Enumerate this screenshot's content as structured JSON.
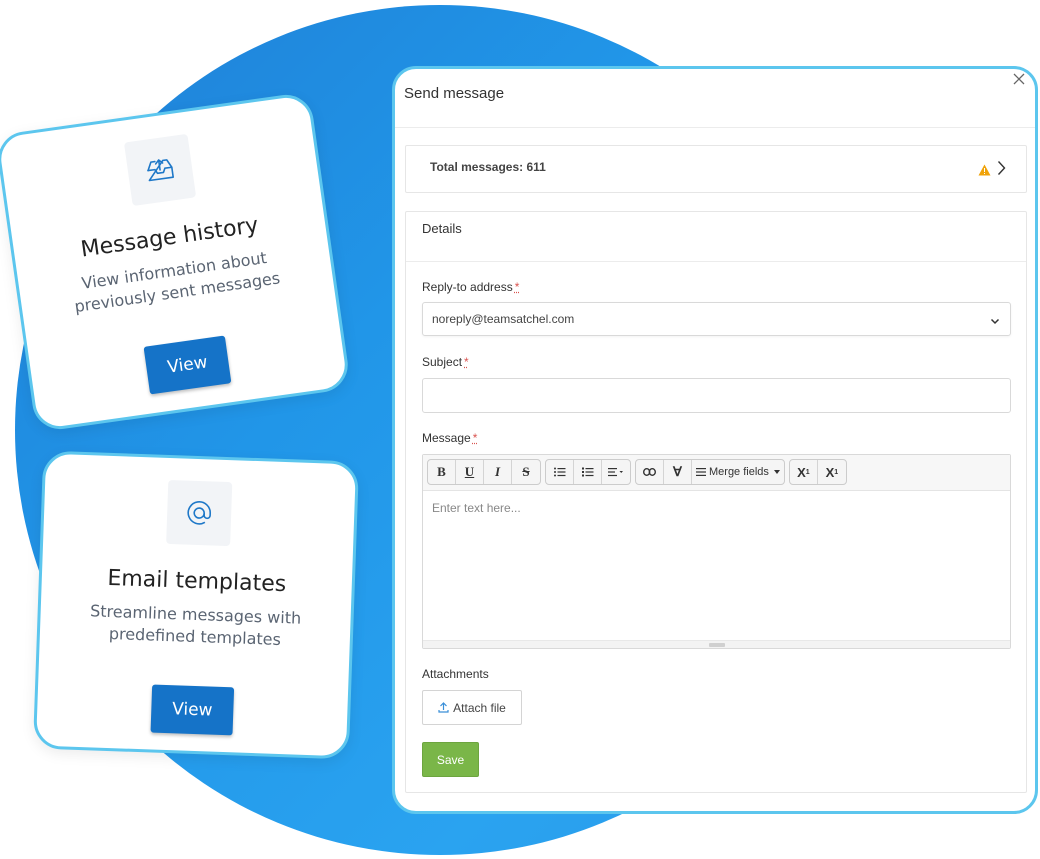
{
  "colors": {
    "background_circle": "#2196e8",
    "card_border": "#5cc6ee",
    "primary_button": "#1573c8",
    "save_button": "#7ab648",
    "warning": "#f0a30a",
    "required": "#d9534f"
  },
  "cards": [
    {
      "icon": "inbox-upload-icon",
      "title": "Message history",
      "description": "View information about previously sent messages",
      "button_label": "View"
    },
    {
      "icon": "at-sign-icon",
      "title": "Email templates",
      "description": "Streamline messages with predefined templates",
      "button_label": "View"
    }
  ],
  "modal": {
    "title": "Send message",
    "close_icon": "close-icon",
    "total_messages_label": "Total messages: 611",
    "details_heading": "Details",
    "reply_to": {
      "label": "Reply-to address",
      "required_mark": "*",
      "value": "noreply@teamsatchel.com"
    },
    "subject": {
      "label": "Subject",
      "required_mark": "*",
      "value": ""
    },
    "message": {
      "label": "Message",
      "required_mark": "*",
      "placeholder": "Enter text here...",
      "toolbar": {
        "bold": "B",
        "underline": "U",
        "italic": "I",
        "strikethrough": "S",
        "merge_fields": "Merge fields",
        "superscript": "X",
        "subscript": "X"
      }
    },
    "attachments": {
      "label": "Attachments",
      "button_label": "Attach file"
    },
    "save_label": "Save"
  }
}
